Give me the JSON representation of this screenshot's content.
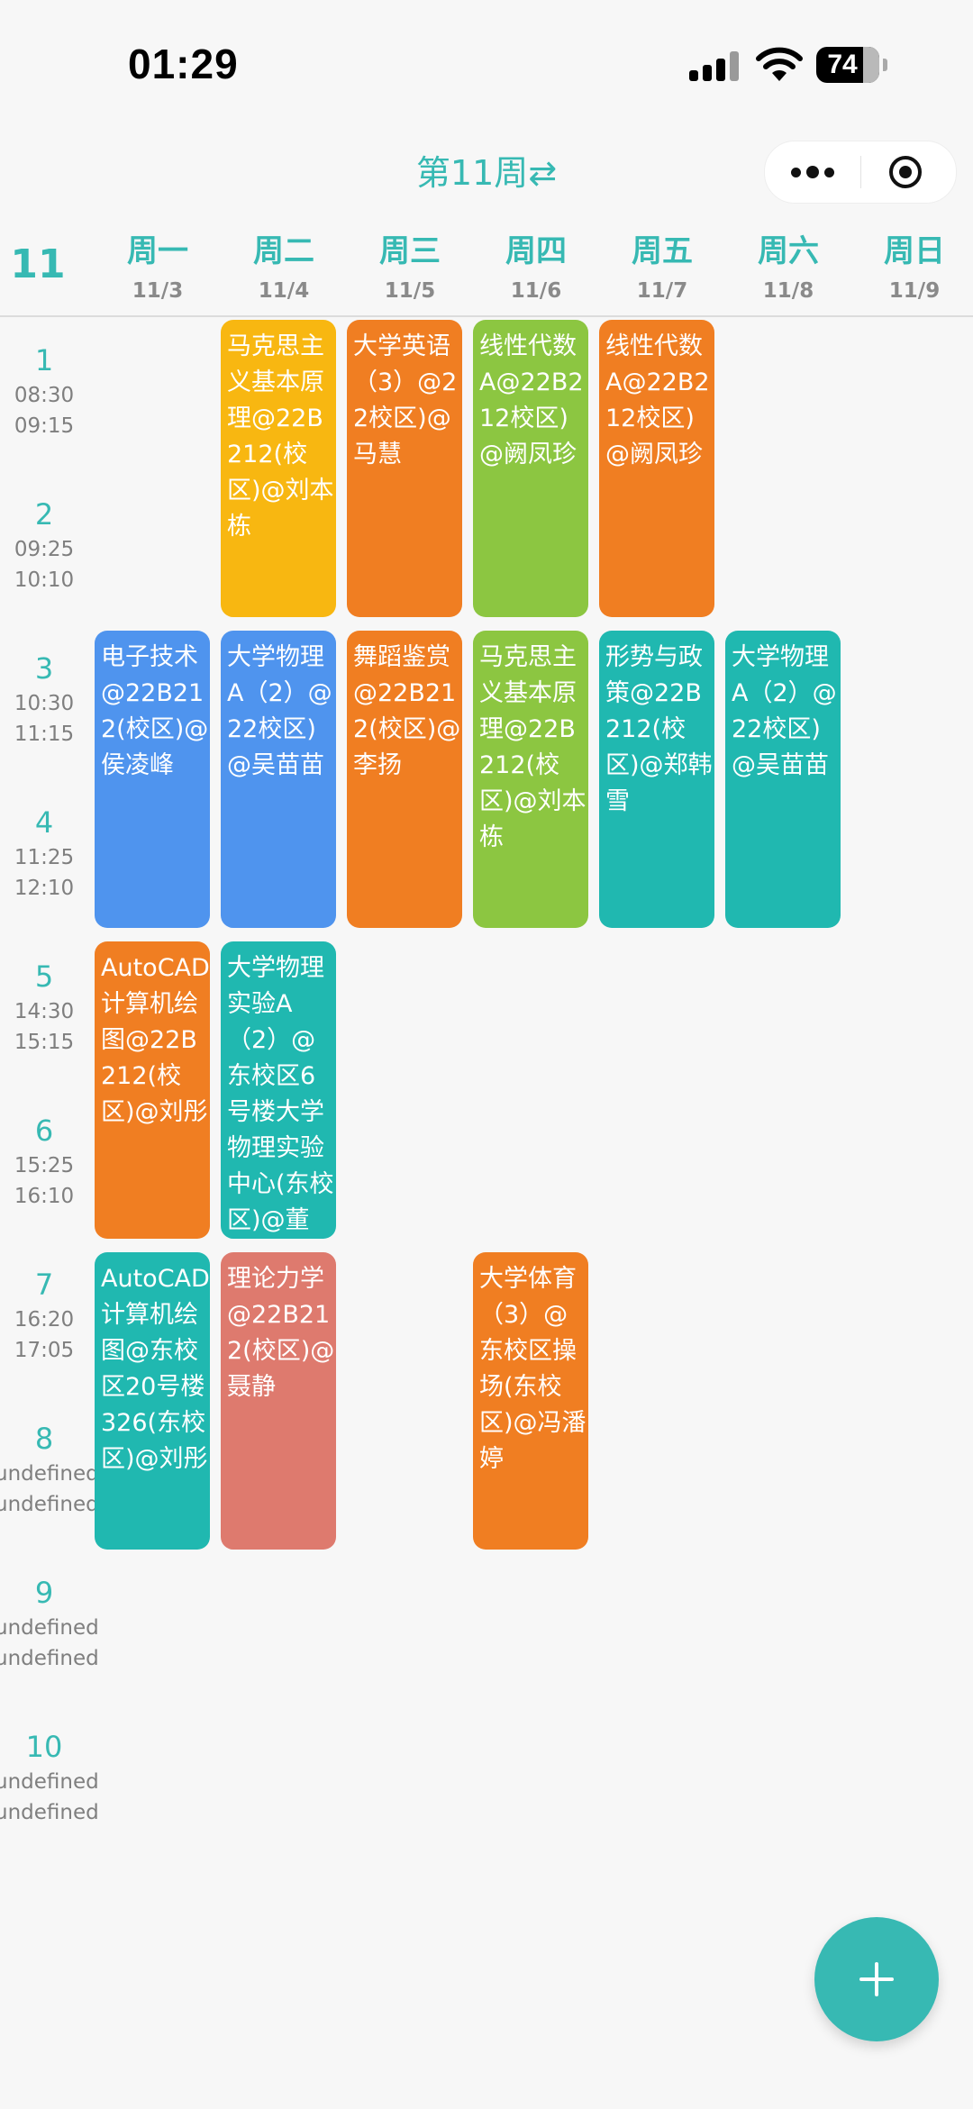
{
  "status_bar": {
    "time": "01:29",
    "battery": "74"
  },
  "nav": {
    "title": "第11周⇄",
    "capsule_icons": [
      "more-icon",
      "target-icon"
    ]
  },
  "week_number": "11",
  "days": [
    {
      "name": "周一",
      "date": "11/3"
    },
    {
      "name": "周二",
      "date": "11/4"
    },
    {
      "name": "周三",
      "date": "11/5"
    },
    {
      "name": "周四",
      "date": "11/6"
    },
    {
      "name": "周五",
      "date": "11/7"
    },
    {
      "name": "周六",
      "date": "11/8"
    },
    {
      "name": "周日",
      "date": "11/9"
    }
  ],
  "slots": [
    {
      "num": "1",
      "start": "08:30",
      "end": "09:15"
    },
    {
      "num": "2",
      "start": "09:25",
      "end": "10:10"
    },
    {
      "num": "3",
      "start": "10:30",
      "end": "11:15"
    },
    {
      "num": "4",
      "start": "11:25",
      "end": "12:10"
    },
    {
      "num": "5",
      "start": "14:30",
      "end": "15:15"
    },
    {
      "num": "6",
      "start": "15:25",
      "end": "16:10"
    },
    {
      "num": "7",
      "start": "16:20",
      "end": "17:05"
    },
    {
      "num": "8",
      "start": "undefined",
      "end": "undefined"
    },
    {
      "num": "9",
      "start": "undefined",
      "end": "undefined"
    },
    {
      "num": "10",
      "start": "undefined",
      "end": "undefined"
    }
  ],
  "courses": [
    {
      "day": 1,
      "slot": 1,
      "text": "马克思主义基本原理@22B212(校区)@刘本栋",
      "color": "#f8b711"
    },
    {
      "day": 2,
      "slot": 1,
      "text": "大学英语（3）@22校区)@马慧",
      "color": "#f07e22"
    },
    {
      "day": 3,
      "slot": 1,
      "text": "线性代数A@22B212校区)@阙凤珍",
      "color": "#8cc641"
    },
    {
      "day": 4,
      "slot": 1,
      "text": "线性代数A@22B212校区)@阙凤珍",
      "color": "#f07e22"
    },
    {
      "day": 0,
      "slot": 3,
      "text": "电子技术@22B212(校区)@侯凌峰",
      "color": "#4f94ee"
    },
    {
      "day": 1,
      "slot": 3,
      "text": "大学物理A（2）@22校区)@吴苗苗",
      "color": "#4f94ee"
    },
    {
      "day": 2,
      "slot": 3,
      "text": "舞蹈鉴赏@22B212(校区)@李扬",
      "color": "#f07e22"
    },
    {
      "day": 3,
      "slot": 3,
      "text": "马克思主义基本原理@22B212(校区)@刘本栋",
      "color": "#8cc641"
    },
    {
      "day": 4,
      "slot": 3,
      "text": "形势与政策@22B212(校区)@郑韩雪",
      "color": "#20b8b0"
    },
    {
      "day": 5,
      "slot": 3,
      "text": "大学物理A（2）@22校区)@吴苗苗",
      "color": "#20b8b0"
    },
    {
      "day": 0,
      "slot": 5,
      "text": "AutoCAD计算机绘图@22B212(校区)@刘彤",
      "color": "#f07e22"
    },
    {
      "day": 1,
      "slot": 5,
      "text": "大学物理实验A（2）@东校区6号楼大学物理实验中心(东校区)@董",
      "color": "#20b8b0"
    },
    {
      "day": 0,
      "slot": 7,
      "text": "AutoCAD计算机绘图@东校区20号楼326(东校区)@刘彤",
      "color": "#20b8b0"
    },
    {
      "day": 1,
      "slot": 7,
      "text": "理论力学@22B212(校区)@聂静",
      "color": "#de7a6e"
    },
    {
      "day": 3,
      "slot": 7,
      "text": "大学体育（3）@东校区操场(东校区)@冯潘婷",
      "color": "#f07e22"
    }
  ],
  "fab": {
    "icon": "plus-icon"
  }
}
